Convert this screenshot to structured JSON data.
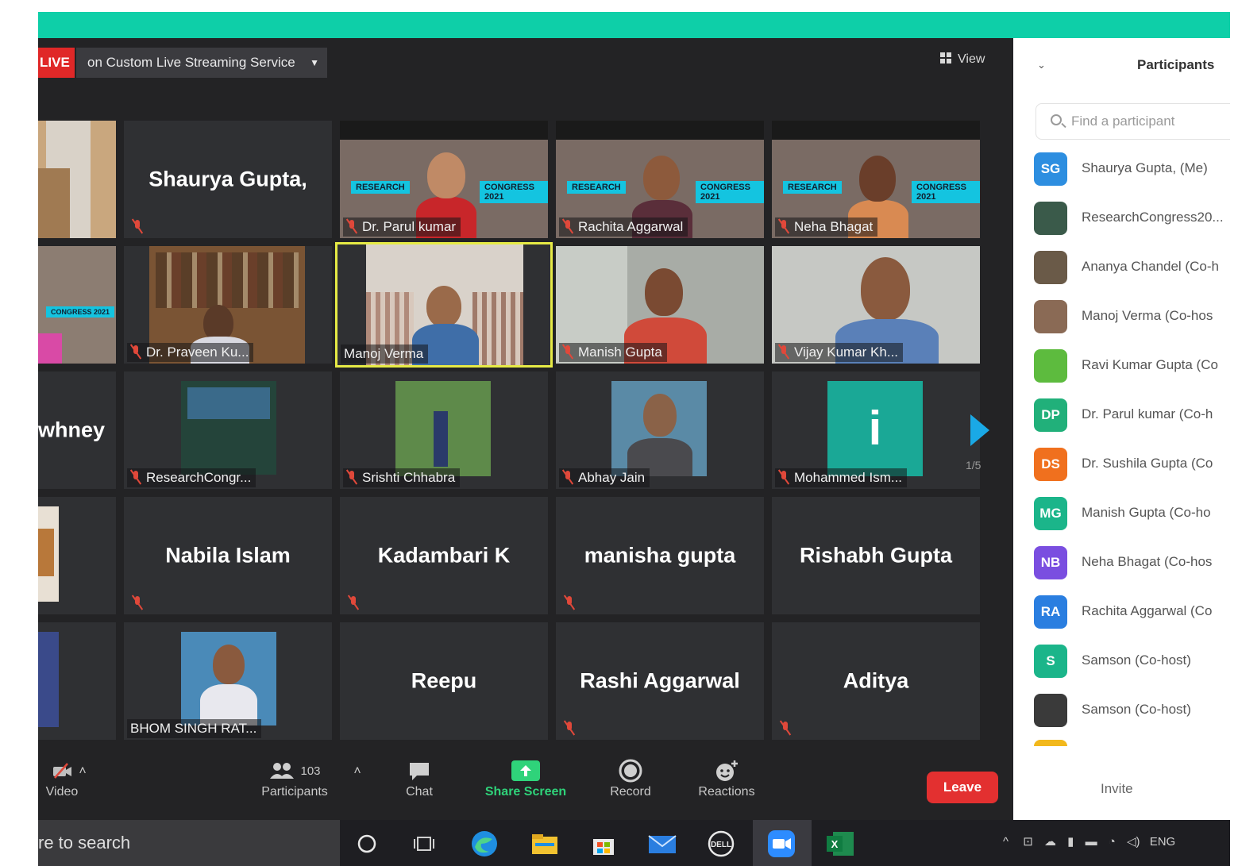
{
  "header": {
    "live_badge": "LIVE",
    "stream_service": "on Custom Live Streaming Service",
    "view_label": "View"
  },
  "tiles": {
    "shaurya": "Shaurya Gupta,",
    "parul": "Dr. Parul kumar",
    "rachita": "Rachita Aggarwal",
    "neha": "Neha Bhagat",
    "praveen": "Dr. Praveen Ku...",
    "manoj": "Manoj Verma",
    "manish": "Manish Gupta",
    "vijay": "Vijay Kumar Kh...",
    "sawhney_fragment": "whney",
    "research": "ResearchCongr...",
    "srishti": "Srishti Chhabra",
    "abhay": "Abhay Jain",
    "mohammed": "Mohammed Ism...",
    "mohammed_initial": "i",
    "nabila": "Nabila Islam",
    "kadambari": "Kadambari K",
    "manisha": "manisha gupta",
    "rishabh": "Rishabh Gupta",
    "bhom": "BHOM SINGH RAT...",
    "reepu": "Reepu",
    "rashi": "Rashi Aggarwal",
    "aditya": "Aditya",
    "research_tag": "RESEARCH",
    "congress_tag": "CONGRESS 2021"
  },
  "pager": {
    "text": "1/5"
  },
  "toolbar": {
    "video_label": "Video",
    "participants_label": "Participants",
    "participants_count": "103",
    "chat_label": "Chat",
    "share_label": "Share Screen",
    "record_label": "Record",
    "reactions_label": "Reactions",
    "leave_label": "Leave"
  },
  "panel": {
    "title": "Participants",
    "search_placeholder": "Find a participant",
    "invite_label": "Invite",
    "participants": [
      {
        "initials": "SG",
        "name": "Shaurya Gupta, (Me)",
        "color": "#2d8ee0"
      },
      {
        "initials": "",
        "name": "ResearchCongress20...",
        "color": "#3a5a4a"
      },
      {
        "initials": "",
        "name": "Ananya Chandel (Co-h",
        "color": "#6a5a48"
      },
      {
        "initials": "",
        "name": "Manoj Verma (Co-hos",
        "color": "#8a6a55"
      },
      {
        "initials": "",
        "name": "Ravi Kumar Gupta (Co",
        "color": "#5dbb3e"
      },
      {
        "initials": "DP",
        "name": "Dr. Parul kumar (Co-h",
        "color": "#21b07a"
      },
      {
        "initials": "DS",
        "name": "Dr. Sushila Gupta (Co",
        "color": "#f0701e"
      },
      {
        "initials": "MG",
        "name": "Manish Gupta (Co-ho",
        "color": "#1bb58a"
      },
      {
        "initials": "NB",
        "name": "Neha Bhagat (Co-hos",
        "color": "#7a4ee0"
      },
      {
        "initials": "RA",
        "name": "Rachita Aggarwal (Co",
        "color": "#2a7ee0"
      },
      {
        "initials": "S",
        "name": "Samson (Co-host)",
        "color": "#1bb58a"
      },
      {
        "initials": "",
        "name": "Samson (Co-host)",
        "color": "#3a3a3a"
      }
    ]
  },
  "taskbar": {
    "search_text": "re to search",
    "tray_text": "ENG"
  },
  "colors": {
    "accent_bar": "#0ecfa8",
    "live_red": "#e02828",
    "share_green": "#2fd37a",
    "leave_red": "#e33030",
    "active_speaker": "#e6ea45"
  }
}
